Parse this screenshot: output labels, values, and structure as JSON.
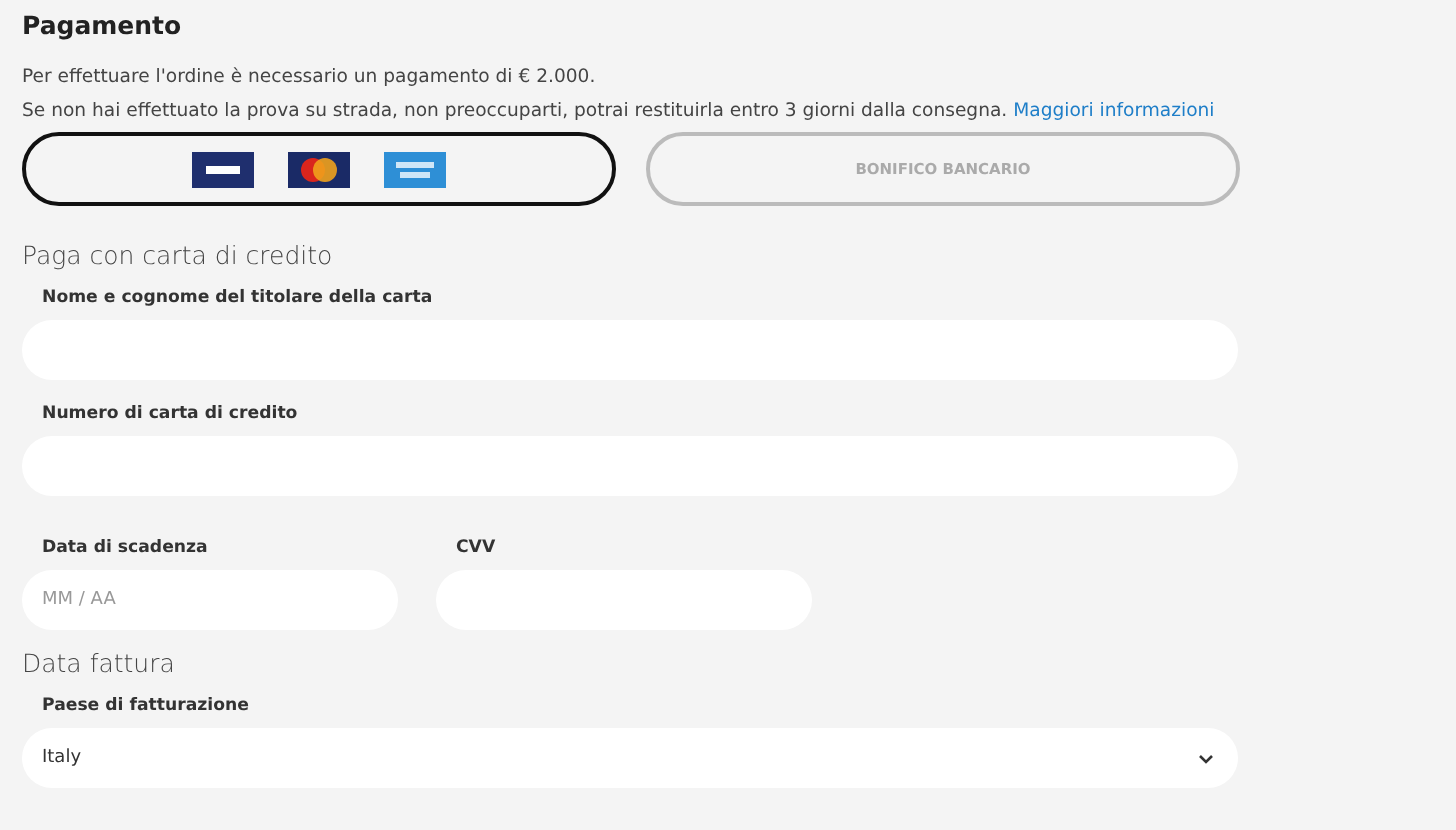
{
  "title": "Pagamento",
  "notice": "Per effettuare l'ordine è necessario un pagamento di € 2.000.",
  "info": {
    "text": "Se non hai effettuato la prova su strada, non preoccuparti, potrai restituirla entro 3 giorni dalla consegna.",
    "link": "Maggiori informazioni"
  },
  "payment_methods": [
    {
      "kind": "cards",
      "selected": true
    },
    {
      "kind": "text",
      "label": "BONIFICO BANCARIO",
      "selected": false
    }
  ],
  "card_section": {
    "heading": "Paga con carta di credito",
    "fields": [
      {
        "label": "Nome e cognome del titolare della carta"
      },
      {
        "label": "Numero di carta di credito"
      }
    ],
    "row_fields": [
      {
        "label": "Data di scadenza",
        "placeholder": "MM / AA"
      },
      {
        "label": "CVV"
      }
    ]
  },
  "invoice_section": {
    "heading": "Data fattura",
    "country": {
      "label": "Paese di fatturazione",
      "value": "Italy"
    }
  }
}
